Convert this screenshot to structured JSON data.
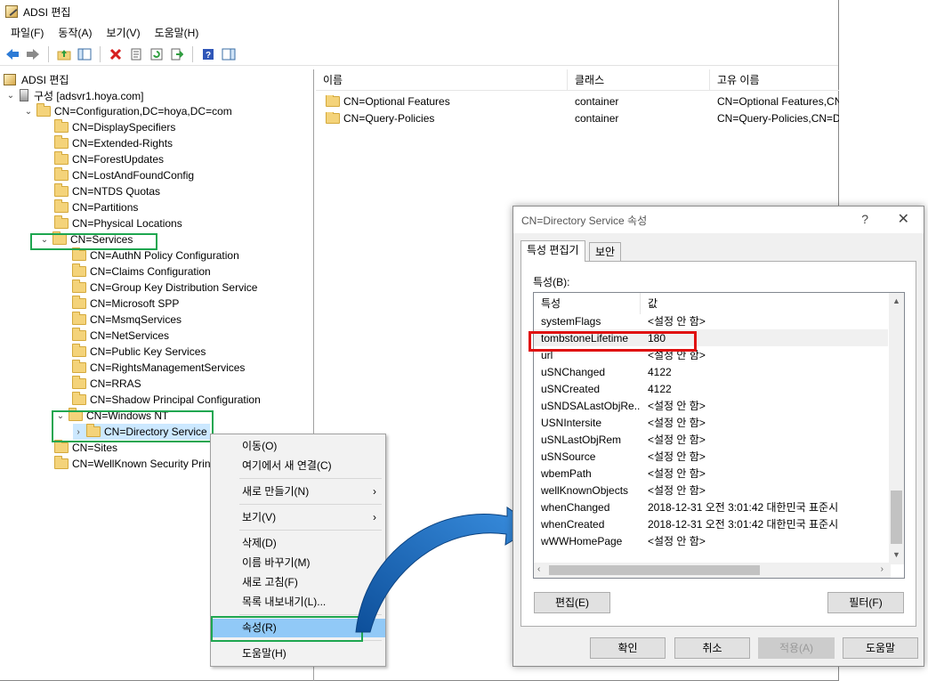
{
  "window": {
    "title": "ADSI 편집",
    "menus": [
      "파일(F)",
      "동작(A)",
      "보기(V)",
      "도움말(H)"
    ]
  },
  "toolbar": {
    "icons": [
      "back-arrow-icon",
      "forward-arrow-icon",
      "up-folder-icon",
      "show-hide-tree-icon",
      "delete-icon",
      "properties-icon",
      "refresh-icon",
      "export-list-icon",
      "help-icon",
      "action-pane-icon"
    ]
  },
  "tree": {
    "root": "ADSI 편집",
    "server": "구성 [adsvr1.hoya.com]",
    "config": "CN=Configuration,DC=hoya,DC=com",
    "level1": [
      "CN=DisplaySpecifiers",
      "CN=Extended-Rights",
      "CN=ForestUpdates",
      "CN=LostAndFoundConfig",
      "CN=NTDS Quotas",
      "CN=Partitions",
      "CN=Physical Locations"
    ],
    "services": "CN=Services",
    "services_children": [
      "CN=AuthN Policy Configuration",
      "CN=Claims Configuration",
      "CN=Group Key Distribution Service",
      "CN=Microsoft SPP",
      "CN=MsmqServices",
      "CN=NetServices",
      "CN=Public Key Services",
      "CN=RightsManagementServices",
      "CN=RRAS",
      "CN=Shadow Principal Configuration"
    ],
    "windows_nt": "CN=Windows NT",
    "directory_service": "CN=Directory Service",
    "sites": "CN=Sites",
    "wellknown": "CN=WellKnown Security Principals"
  },
  "list": {
    "headers": [
      "이름",
      "클래스",
      "고유 이름"
    ],
    "rows": [
      {
        "name": "CN=Optional Features",
        "class": "container",
        "dn": "CN=Optional Features,CN=Directory Service,CN=Windows NT"
      },
      {
        "name": "CN=Query-Policies",
        "class": "container",
        "dn": "CN=Query-Policies,CN=Directory Service,CN=Windows NT"
      }
    ]
  },
  "context_menu": {
    "move": "이동(O)",
    "connect_here": "여기에서 새 연결(C)",
    "new": "새로 만들기(N)",
    "view": "보기(V)",
    "delete": "삭제(D)",
    "rename": "이름 바꾸기(M)",
    "refresh": "새로 고침(F)",
    "export": "목록 내보내기(L)...",
    "properties": "속성(R)",
    "help": "도움말(H)",
    "submenu_arrow": "›"
  },
  "dialog": {
    "title": "CN=Directory Service 속성",
    "help_glyph": "?",
    "close_glyph": "✕",
    "tabs": [
      "특성 편집기",
      "보안"
    ],
    "attributes_label": "특성(B):",
    "grid_headers": [
      "특성",
      "값"
    ],
    "rows": [
      {
        "name": "systemFlags",
        "value": "<설정 안 함>"
      },
      {
        "name": "tombstoneLifetime",
        "value": "180"
      },
      {
        "name": "url",
        "value": "<설정 안 함>"
      },
      {
        "name": "uSNChanged",
        "value": "4122"
      },
      {
        "name": "uSNCreated",
        "value": "4122"
      },
      {
        "name": "uSNDSALastObjRe...",
        "value": "<설정 안 함>"
      },
      {
        "name": "USNIntersite",
        "value": "<설정 안 함>"
      },
      {
        "name": "uSNLastObjRem",
        "value": "<설정 안 함>"
      },
      {
        "name": "uSNSource",
        "value": "<설정 안 함>"
      },
      {
        "name": "wbemPath",
        "value": "<설정 안 함>"
      },
      {
        "name": "wellKnownObjects",
        "value": "<설정 안 함>"
      },
      {
        "name": "whenChanged",
        "value": "2018-12-31 오전 3:01:42 대한민국 표준시"
      },
      {
        "name": "whenCreated",
        "value": "2018-12-31 오전 3:01:42 대한민국 표준시"
      },
      {
        "name": "wWWHomePage",
        "value": "<설정 안 함>"
      }
    ],
    "edit_button": "편집(E)",
    "filter_button": "필터(F)",
    "ok_button": "확인",
    "cancel_button": "취소",
    "apply_button": "적용(A)",
    "help_button": "도움말"
  },
  "colors": {
    "highlight_green": "#1ea650",
    "highlight_red": "#e01010",
    "arrow_blue": "#1f6fc0",
    "menu_highlight": "#91c9f7"
  }
}
